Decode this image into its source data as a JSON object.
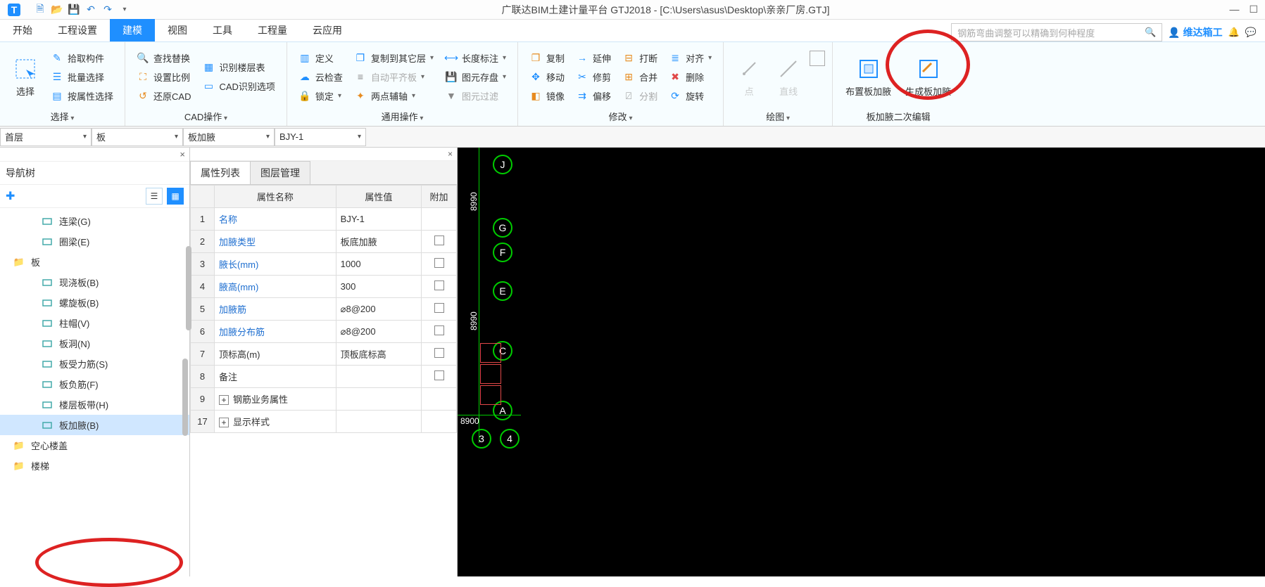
{
  "app": {
    "title": "广联达BIM土建计量平台 GTJ2018 - [C:\\Users\\asus\\Desktop\\亲亲厂房.GTJ]"
  },
  "menu": {
    "items": [
      "开始",
      "工程设置",
      "建模",
      "视图",
      "工具",
      "工程量",
      "云应用"
    ],
    "activeIndex": 2,
    "searchPlaceholder": "钢筋弯曲调整可以精确到何种程度",
    "userName": "维达箱工"
  },
  "ribbon": {
    "select": {
      "big": "选择",
      "items": [
        "拾取构件",
        "批量选择",
        "按属性选择"
      ],
      "label": "选择"
    },
    "cad": {
      "col1": [
        "查找替换",
        "设置比例",
        "还原CAD"
      ],
      "col2": [
        "识别楼层表",
        "CAD识别选项"
      ],
      "label": "CAD操作"
    },
    "general": {
      "col1": [
        "定义",
        "云检查",
        "锁定"
      ],
      "col2": [
        "复制到其它层",
        "自动平齐板",
        "两点辅轴"
      ],
      "col3": [
        "长度标注",
        "图元存盘",
        "图元过滤"
      ],
      "label": "通用操作"
    },
    "modify": {
      "col1": [
        "复制",
        "移动",
        "镜像"
      ],
      "col2": [
        "延伸",
        "修剪",
        "偏移"
      ],
      "col3": [
        "打断",
        "合并",
        "分割"
      ],
      "col4": [
        "对齐",
        "删除",
        "旋转"
      ],
      "label": "修改"
    },
    "draw": {
      "items": [
        "点",
        "直线"
      ],
      "label": "绘图"
    },
    "haunch": {
      "btn1": "布置板加腋",
      "btn2": "生成板加腋",
      "label": "板加腋二次编辑"
    }
  },
  "filters": {
    "f1": "首层",
    "f2": "板",
    "f3": "板加腋",
    "f4": "BJY-1"
  },
  "nav": {
    "title": "导航树",
    "items": [
      {
        "icon": "beam-icon",
        "label": "连梁(G)",
        "level": 1,
        "color": "#4aa"
      },
      {
        "icon": "ring-icon",
        "label": "圈梁(E)",
        "level": 1,
        "color": "#4aa"
      },
      {
        "icon": "folder-icon",
        "label": "板",
        "level": 0,
        "color": "#e7a94a"
      },
      {
        "icon": "slab-icon",
        "label": "现浇板(B)",
        "level": 1,
        "color": "#4aa"
      },
      {
        "icon": "spiral-icon",
        "label": "螺旋板(B)",
        "level": 1,
        "color": "#4aa"
      },
      {
        "icon": "cap-icon",
        "label": "柱帽(V)",
        "level": 1,
        "color": "#4aa"
      },
      {
        "icon": "hole-icon",
        "label": "板洞(N)",
        "level": 1,
        "color": "#4aa"
      },
      {
        "icon": "rebar-icon",
        "label": "板受力筋(S)",
        "level": 1,
        "color": "#4aa"
      },
      {
        "icon": "neg-icon",
        "label": "板负筋(F)",
        "level": 1,
        "color": "#4aa"
      },
      {
        "icon": "band-icon",
        "label": "楼层板带(H)",
        "level": 1,
        "color": "#4aa"
      },
      {
        "icon": "haunch-icon",
        "label": "板加腋(B)",
        "level": 1,
        "color": "#4aa",
        "selected": true
      },
      {
        "icon": "folder-icon",
        "label": "空心楼盖",
        "level": 0,
        "color": "#e7a94a"
      },
      {
        "icon": "folder-icon",
        "label": "楼梯",
        "level": 0,
        "color": "#e7a94a"
      }
    ]
  },
  "attrs": {
    "tab1": "属性列表",
    "tab2": "图层管理",
    "headers": [
      "",
      "属性名称",
      "属性值",
      "附加"
    ],
    "rows": [
      {
        "n": "1",
        "name": "名称",
        "link": true,
        "value": "BJY-1",
        "chk": false
      },
      {
        "n": "2",
        "name": "加腋类型",
        "link": true,
        "value": "板底加腋",
        "chk": true
      },
      {
        "n": "3",
        "name": "腋长(mm)",
        "link": true,
        "value": "1000",
        "chk": true
      },
      {
        "n": "4",
        "name": "腋高(mm)",
        "link": true,
        "value": "300",
        "chk": true
      },
      {
        "n": "5",
        "name": "加腋筋",
        "link": true,
        "value": "⌀8@200",
        "chk": true
      },
      {
        "n": "6",
        "name": "加腋分布筋",
        "link": true,
        "value": "⌀8@200",
        "chk": true
      },
      {
        "n": "7",
        "name": "顶标高(m)",
        "link": false,
        "value": "顶板底标高",
        "chk": true
      },
      {
        "n": "8",
        "name": "备注",
        "link": false,
        "value": "",
        "chk": true
      },
      {
        "n": "9",
        "name": "钢筋业务属性",
        "link": false,
        "value": "",
        "chk": false,
        "exp": true
      },
      {
        "n": "17",
        "name": "显示样式",
        "link": false,
        "value": "",
        "chk": false,
        "exp": true
      }
    ]
  },
  "canvas": {
    "gridLetters": [
      "J",
      "G",
      "F",
      "E",
      "C",
      "A"
    ],
    "gridNums": [
      "3",
      "4"
    ],
    "dims": [
      "8990",
      "8990"
    ]
  }
}
